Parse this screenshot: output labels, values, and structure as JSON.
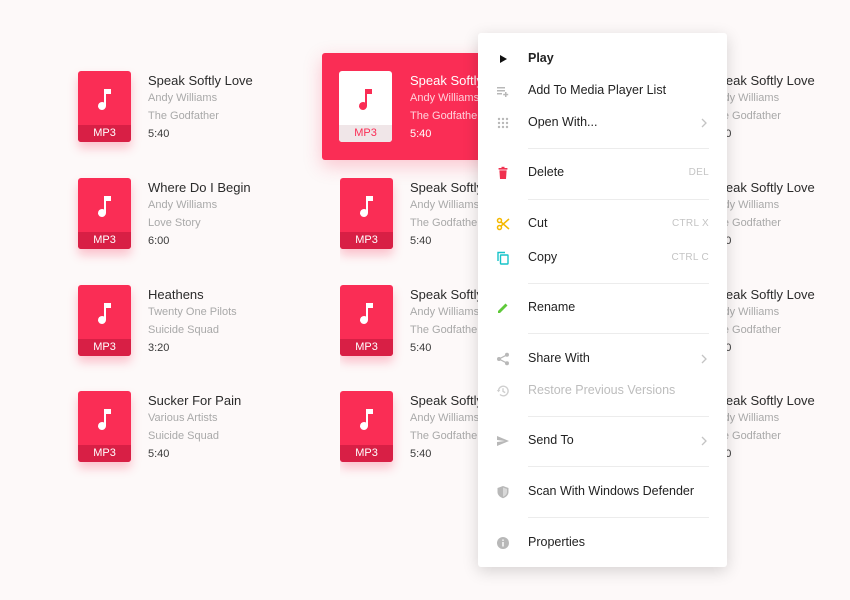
{
  "files": [
    {
      "title": "Speak Softly Love",
      "artist": "Andy Williams",
      "album": "The Godfather",
      "duration": "5:40",
      "ext": "MP3"
    },
    {
      "title": "Speak Softly Love",
      "artist": "Andy Williams",
      "album": "The Godfather",
      "duration": "5:40",
      "ext": "MP3"
    },
    {
      "title": "Speak Softly Love",
      "artist": "Andy Williams",
      "album": "The Godfather",
      "duration": "5:40",
      "ext": "MP3"
    },
    {
      "title": "Where Do I Begin",
      "artist": "Andy Williams",
      "album": "Love Story",
      "duration": "6:00",
      "ext": "MP3"
    },
    {
      "title": "Speak Softly Love",
      "artist": "Andy Williams",
      "album": "The Godfather",
      "duration": "5:40",
      "ext": "MP3"
    },
    {
      "title": "Speak Softly Love",
      "artist": "Andy Williams",
      "album": "The Godfather",
      "duration": "5:40",
      "ext": "MP3"
    },
    {
      "title": "Heathens",
      "artist": "Twenty One Pilots",
      "album": "Suicide Squad",
      "duration": "3:20",
      "ext": "MP3"
    },
    {
      "title": "Speak Softly Love",
      "artist": "Andy Williams",
      "album": "The Godfather",
      "duration": "5:40",
      "ext": "MP3"
    },
    {
      "title": "Speak Softly Love",
      "artist": "Andy Williams",
      "album": "The Godfather",
      "duration": "5:40",
      "ext": "MP3"
    },
    {
      "title": "Sucker For Pain",
      "artist": "Various Artists",
      "album": "Suicide Squad",
      "duration": "5:40",
      "ext": "MP3"
    },
    {
      "title": "Speak Softly Love",
      "artist": "Andy Williams",
      "album": "The Godfather",
      "duration": "5:40",
      "ext": "MP3"
    },
    {
      "title": "Speak Softly Love",
      "artist": "Andy Williams",
      "album": "The Godfather",
      "duration": "5:40",
      "ext": "MP3"
    }
  ],
  "menu": {
    "play": "Play",
    "add_to_list": "Add To Media Player List",
    "open_with": "Open With...",
    "delete": "Delete",
    "delete_shortcut": "DEL",
    "cut": "Cut",
    "cut_shortcut": "CTRL X",
    "copy": "Copy",
    "copy_shortcut": "CTRL C",
    "rename": "Rename",
    "share_with": "Share With",
    "restore": "Restore Previous Versions",
    "send_to": "Send To",
    "scan": "Scan With Windows Defender",
    "properties": "Properties"
  },
  "colors": {
    "accent": "#fa2d55",
    "accent_dark": "#d81f45",
    "delete_icon": "#f0314f",
    "cut_icon": "#f5b800",
    "copy_icon": "#17c3c9",
    "rename_icon": "#5fc93a",
    "muted_icon": "#b8b8b8"
  },
  "icons": {
    "file_thumb": "music-note-icon",
    "play": "play-icon",
    "add_to_list": "playlist-add-icon",
    "open_with": "apps-grid-icon",
    "delete": "trash-icon",
    "cut": "scissors-icon",
    "copy": "copy-icon",
    "rename": "pencil-icon",
    "share_with": "share-icon",
    "restore": "history-icon",
    "send_to": "send-icon",
    "scan": "shield-icon",
    "properties": "info-icon",
    "submenu": "chevron-right-icon"
  }
}
